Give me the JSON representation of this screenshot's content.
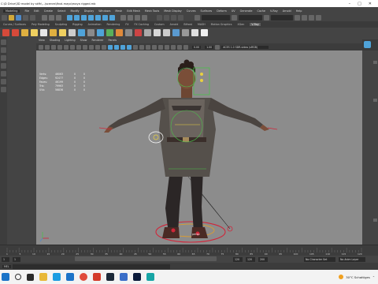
{
  "window": {
    "title": "C:\\D Drive\\3D model by skfh\\...\\scenes\\final.mayo\\maya rigged.mb"
  },
  "menubar": {
    "items": [
      "File",
      "Edit",
      "Create",
      "Select",
      "Modify",
      "Display",
      "Windows",
      "Mesh",
      "Edit Mesh",
      "Mesh Tools",
      "Mesh Display",
      "Curves",
      "Surfaces",
      "Deform",
      "UV",
      "Generate",
      "Cache",
      "V-Ray",
      "Arnold",
      "Help"
    ],
    "mode": "Modeling",
    "live_surface": "No Live Surface",
    "symmetry": "Symmetry: Off",
    "sign_in": "Sign In"
  },
  "shelf_tabs": {
    "tabs": [
      "Curves / Surfaces",
      "Poly Modeling",
      "Sculpting",
      "Rigging",
      "Animation",
      "Rendering",
      "FX",
      "FX Caching",
      "Custom",
      "Arnold",
      "Bifrost",
      "MASH",
      "Motion Graphics",
      "XGen",
      "V-Ray"
    ],
    "active_index": 14
  },
  "panel": {
    "menus": [
      "View",
      "Shading",
      "Lighting",
      "Show",
      "Renderer",
      "Panels"
    ],
    "near_clip": "0.00",
    "far_clip": "1.00",
    "color_space": "ACES 1.0 SDR-video (sRGB)"
  },
  "hud": {
    "rows": [
      {
        "label": "Verts:",
        "value": "46063",
        "sel": "0",
        "comp": "0"
      },
      {
        "label": "Edges:",
        "value": "92477",
        "sel": "0",
        "comp": "0"
      },
      {
        "label": "Faces:",
        "value": "46199",
        "sel": "0",
        "comp": "0"
      },
      {
        "label": "Tris:",
        "value": "79963",
        "sel": "0",
        "comp": "0"
      },
      {
        "label": "UVs:",
        "value": "56836",
        "sel": "0",
        "comp": "0"
      }
    ]
  },
  "viewport": {
    "camera_label": "persp"
  },
  "timeslider": {
    "ticks": [
      "1",
      "5",
      "10",
      "15",
      "20",
      "25",
      "30",
      "35",
      "40",
      "45",
      "50",
      "55",
      "60",
      "65",
      "70",
      "75",
      "80",
      "85",
      "90",
      "95",
      "100",
      "105",
      "110",
      "115",
      "120"
    ]
  },
  "range": {
    "start": "1",
    "playback_start": "1",
    "playback_end": "120",
    "end": "120",
    "fps_end": "200",
    "character_set": "No Character Set",
    "anim_layer": "No Anim Layer"
  },
  "cmdline": {
    "lang": "MEL"
  },
  "taskbar": {
    "weather": "30°C  Schattiges",
    "time": "",
    "icons": [
      "start",
      "search",
      "task-view",
      "file-explorer",
      "edge",
      "mail",
      "chrome",
      "media",
      "steam",
      "store",
      "photoshop",
      "maya"
    ]
  },
  "colors": {
    "accent": "#4fa3d9",
    "viewport_bg": "#8c8c8c",
    "ui_dark": "#444444"
  }
}
